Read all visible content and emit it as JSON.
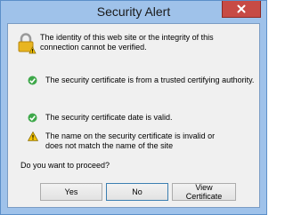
{
  "window": {
    "title": "Security Alert"
  },
  "intro": {
    "text": "The identity of this web site or the integrity of this connection cannot be verified."
  },
  "statuses": [
    {
      "text": "The security certificate is from a trusted certifying authority.",
      "icon": "check-icon",
      "color": "#3ea84a"
    },
    {
      "text": "The security certificate date is valid.",
      "icon": "check-icon",
      "color": "#3ea84a"
    },
    {
      "text": "The name on the security certificate is invalid or does not match the name of the site",
      "icon": "warning-icon",
      "color": "#f5c400"
    }
  ],
  "question": "Do you want to proceed?",
  "buttons": {
    "yes": "Yes",
    "no": "No",
    "view": "View Certificate"
  },
  "colors": {
    "close": "#c74b45",
    "frame": "#9fc2ea"
  }
}
